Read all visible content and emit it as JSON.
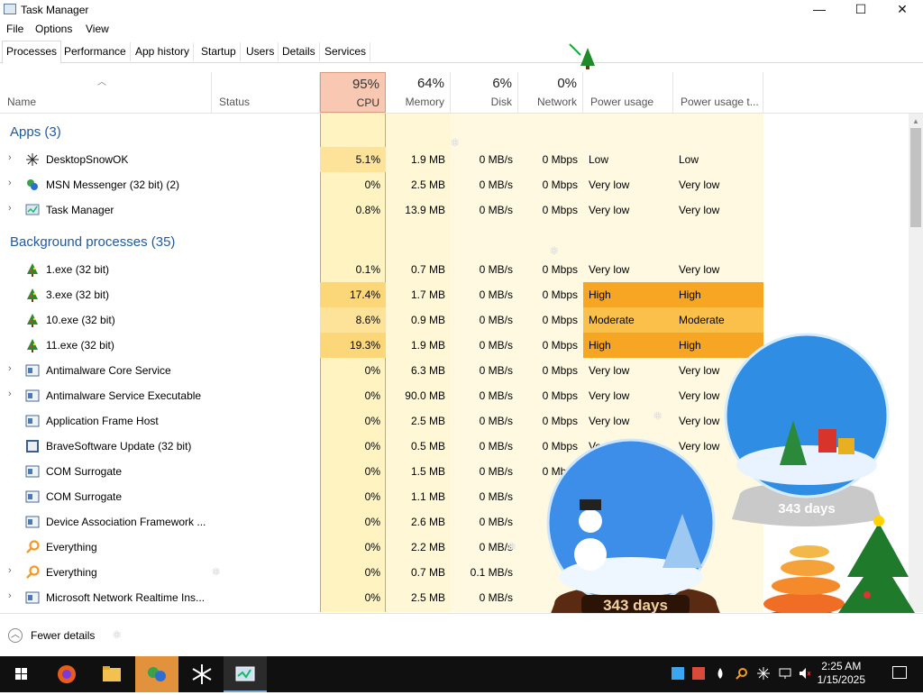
{
  "window": {
    "title": "Task Manager",
    "minimize": "—",
    "maximize": "☐",
    "close": "✕"
  },
  "menu": [
    "File",
    "Options",
    "View"
  ],
  "tabs": [
    "Processes",
    "Performance",
    "App history",
    "Startup",
    "Users",
    "Details",
    "Services"
  ],
  "columns": {
    "name": "Name",
    "status": "Status",
    "cpu": {
      "pct": "95%",
      "label": "CPU"
    },
    "memory": {
      "pct": "64%",
      "label": "Memory"
    },
    "disk": {
      "pct": "6%",
      "label": "Disk"
    },
    "network": {
      "pct": "0%",
      "label": "Network"
    },
    "power": "Power usage",
    "power_trend": "Power usage t..."
  },
  "groups": {
    "apps": "Apps (3)",
    "background": "Background processes (35)"
  },
  "apps": [
    {
      "name": "DesktopSnowOK",
      "cpu": "5.1%",
      "mem": "1.9 MB",
      "disk": "0 MB/s",
      "net": "0 Mbps",
      "power": "Low",
      "trend": "Low",
      "expand": true,
      "icon": "snowflake-icon"
    },
    {
      "name": "MSN Messenger (32 bit) (2)",
      "cpu": "0%",
      "mem": "2.5 MB",
      "disk": "0 MB/s",
      "net": "0 Mbps",
      "power": "Very low",
      "trend": "Very low",
      "expand": true,
      "icon": "messenger-icon"
    },
    {
      "name": "Task Manager",
      "cpu": "0.8%",
      "mem": "13.9 MB",
      "disk": "0 MB/s",
      "net": "0 Mbps",
      "power": "Very low",
      "trend": "Very low",
      "expand": true,
      "icon": "task-manager-icon"
    }
  ],
  "background": [
    {
      "name": "1.exe (32 bit)",
      "cpu": "0.1%",
      "mem": "0.7 MB",
      "disk": "0 MB/s",
      "net": "0 Mbps",
      "power": "Very low",
      "trend": "Very low",
      "expand": false,
      "icon": "tree-icon"
    },
    {
      "name": "3.exe (32 bit)",
      "cpu": "17.4%",
      "mem": "1.7 MB",
      "disk": "0 MB/s",
      "net": "0 Mbps",
      "power": "High",
      "trend": "High",
      "expand": false,
      "icon": "tree-icon"
    },
    {
      "name": "10.exe (32 bit)",
      "cpu": "8.6%",
      "mem": "0.9 MB",
      "disk": "0 MB/s",
      "net": "0 Mbps",
      "power": "Moderate",
      "trend": "Moderate",
      "expand": false,
      "icon": "tree-icon"
    },
    {
      "name": "11.exe (32 bit)",
      "cpu": "19.3%",
      "mem": "1.9 MB",
      "disk": "0 MB/s",
      "net": "0 Mbps",
      "power": "High",
      "trend": "High",
      "expand": false,
      "icon": "tree-icon"
    },
    {
      "name": "Antimalware Core Service",
      "cpu": "0%",
      "mem": "6.3 MB",
      "disk": "0 MB/s",
      "net": "0 Mbps",
      "power": "Very low",
      "trend": "Very low",
      "expand": true,
      "icon": "service-icon"
    },
    {
      "name": "Antimalware Service Executable",
      "cpu": "0%",
      "mem": "90.0 MB",
      "disk": "0 MB/s",
      "net": "0 Mbps",
      "power": "Very low",
      "trend": "Very low",
      "expand": true,
      "icon": "service-icon"
    },
    {
      "name": "Application Frame Host",
      "cpu": "0%",
      "mem": "2.5 MB",
      "disk": "0 MB/s",
      "net": "0 Mbps",
      "power": "Very low",
      "trend": "Very low",
      "expand": false,
      "icon": "service-icon"
    },
    {
      "name": "BraveSoftware Update (32 bit)",
      "cpu": "0%",
      "mem": "0.5 MB",
      "disk": "0 MB/s",
      "net": "0 Mbps",
      "power": "Very low",
      "trend": "Very low",
      "expand": false,
      "icon": "update-icon"
    },
    {
      "name": "COM Surrogate",
      "cpu": "0%",
      "mem": "1.5 MB",
      "disk": "0 MB/s",
      "net": "0 Mbps",
      "power": "",
      "trend": "",
      "expand": false,
      "icon": "service-icon"
    },
    {
      "name": "COM Surrogate",
      "cpu": "0%",
      "mem": "1.1 MB",
      "disk": "0 MB/s",
      "net": "",
      "power": "",
      "trend": "",
      "expand": false,
      "icon": "service-icon"
    },
    {
      "name": "Device Association Framework ...",
      "cpu": "0%",
      "mem": "2.6 MB",
      "disk": "0 MB/s",
      "net": "",
      "power": "",
      "trend": "",
      "expand": false,
      "icon": "service-icon"
    },
    {
      "name": "Everything",
      "cpu": "0%",
      "mem": "2.2 MB",
      "disk": "0 MB/s",
      "net": "",
      "power": "",
      "trend": "",
      "expand": false,
      "icon": "search-icon"
    },
    {
      "name": "Everything",
      "cpu": "0%",
      "mem": "0.7 MB",
      "disk": "0.1 MB/s",
      "net": "",
      "power": "",
      "trend": "",
      "expand": true,
      "icon": "search-icon"
    },
    {
      "name": "Microsoft Network Realtime Ins...",
      "cpu": "0%",
      "mem": "2.5 MB",
      "disk": "0 MB/s",
      "net": "",
      "power": "",
      "trend": "",
      "expand": true,
      "icon": "service-icon"
    }
  ],
  "footer": {
    "label": "Fewer details"
  },
  "globes": {
    "left": "343 days",
    "right": "343 days"
  },
  "clock": {
    "time": "2:25 AM",
    "date": "1/15/2025"
  },
  "colors": {
    "cpu_header": "#f9c8b2",
    "cell_light": "#fff4c4",
    "cell_mid": "#ffe9a6",
    "high": "#f6a623",
    "moderate": "#fbc04a",
    "group_text": "#1e5a9c"
  }
}
